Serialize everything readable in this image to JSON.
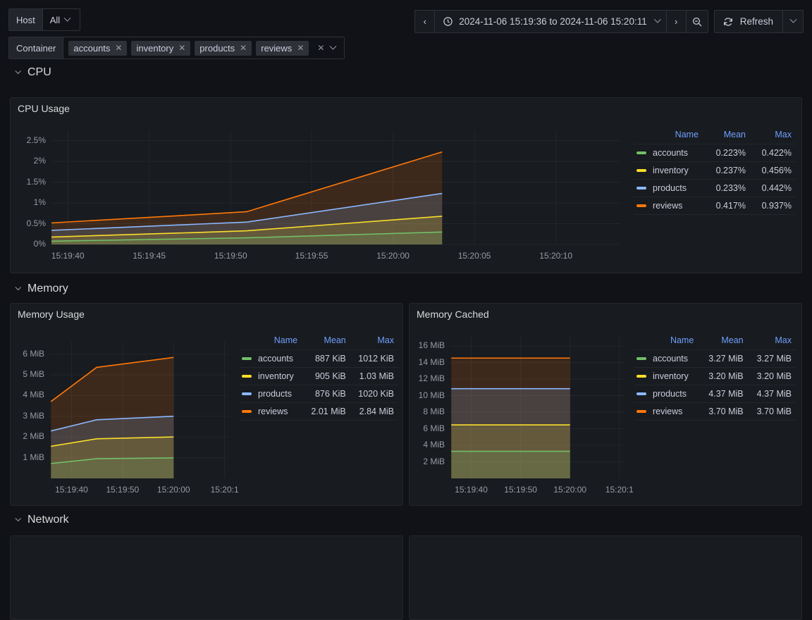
{
  "variables": [
    {
      "name": "host",
      "label": "Host",
      "type": "single",
      "value": "All"
    },
    {
      "name": "container",
      "label": "Container",
      "type": "multi",
      "values": [
        "accounts",
        "inventory",
        "products",
        "reviews"
      ],
      "remove_glyph": "✕",
      "clear_glyph": "✕"
    }
  ],
  "timepicker": {
    "prev_label": "‹",
    "next_label": "›",
    "range": "2024-11-06 15:19:36 to 2024-11-06 15:20:11",
    "clock_icon": "clock-icon",
    "zoom_out_icon": "zoom-out-icon",
    "refresh_label": "Refresh",
    "refresh_icon": "refresh-icon"
  },
  "rows": [
    {
      "name": "cpu",
      "title": "CPU"
    },
    {
      "name": "memory",
      "title": "Memory"
    },
    {
      "name": "network",
      "title": "Network"
    }
  ],
  "colors": {
    "accounts": "#73BF69",
    "inventory": "#FADE2A",
    "products": "#8AB8FF",
    "reviews": "#FF780A",
    "panel_bg": "#181b1f",
    "page_bg": "#111217",
    "grid": "#23262b",
    "header_blue": "#6e9fff"
  },
  "legend_headers": {
    "name": "Name",
    "mean": "Mean",
    "max": "Max"
  },
  "panels": [
    {
      "name": "cpu-usage",
      "title": "CPU Usage",
      "legend": [
        {
          "series": "accounts",
          "mean": "0.223%",
          "max": "0.422%"
        },
        {
          "series": "inventory",
          "mean": "0.237%",
          "max": "0.456%"
        },
        {
          "series": "products",
          "mean": "0.233%",
          "max": "0.442%"
        },
        {
          "series": "reviews",
          "mean": "0.417%",
          "max": "0.937%"
        }
      ]
    },
    {
      "name": "memory-usage",
      "title": "Memory Usage",
      "legend": [
        {
          "series": "accounts",
          "mean": "887 KiB",
          "max": "1012 KiB"
        },
        {
          "series": "inventory",
          "mean": "905 KiB",
          "max": "1.03 MiB"
        },
        {
          "series": "products",
          "mean": "876 KiB",
          "max": "1020 KiB"
        },
        {
          "series": "reviews",
          "mean": "2.01 MiB",
          "max": "2.84 MiB"
        }
      ]
    },
    {
      "name": "memory-cached",
      "title": "Memory Cached",
      "legend": [
        {
          "series": "accounts",
          "mean": "3.27 MiB",
          "max": "3.27 MiB"
        },
        {
          "series": "inventory",
          "mean": "3.20 MiB",
          "max": "3.20 MiB"
        },
        {
          "series": "products",
          "mean": "4.37 MiB",
          "max": "4.37 MiB"
        },
        {
          "series": "reviews",
          "mean": "3.70 MiB",
          "max": "3.70 MiB"
        }
      ]
    }
  ],
  "chart_data": [
    {
      "panel": "cpu-usage",
      "type": "area",
      "stacked": true,
      "title": "CPU Usage",
      "xlabel": "",
      "ylabel": "",
      "ylim": [
        0,
        2.75
      ],
      "yticks": [
        "0%",
        "0.5%",
        "1%",
        "1.5%",
        "2%",
        "2.5%"
      ],
      "ytick_values": [
        0,
        0.5,
        1,
        1.5,
        2,
        2.5
      ],
      "xticks": [
        "15:19:40",
        "15:19:45",
        "15:19:50",
        "15:19:55",
        "15:20:00",
        "15:20:05",
        "15:20:10"
      ],
      "grid": true,
      "legend_position": "right",
      "x": [
        "15:19:36",
        "15:19:45",
        "15:19:48",
        "15:20:00"
      ],
      "series": [
        {
          "name": "accounts",
          "values": [
            0.08,
            0.14,
            0.16,
            0.3
          ]
        },
        {
          "name": "inventory",
          "values": [
            0.1,
            0.15,
            0.17,
            0.38
          ]
        },
        {
          "name": "products",
          "values": [
            0.16,
            0.2,
            0.21,
            0.55
          ]
        },
        {
          "name": "reviews",
          "values": [
            0.18,
            0.23,
            0.25,
            1.0
          ]
        }
      ],
      "cumulative": [
        {
          "name": "accounts",
          "values": [
            0.08,
            0.14,
            0.16,
            0.3
          ]
        },
        {
          "name": "inventory",
          "values": [
            0.18,
            0.29,
            0.33,
            0.68
          ]
        },
        {
          "name": "products",
          "values": [
            0.34,
            0.49,
            0.54,
            1.23
          ]
        },
        {
          "name": "reviews",
          "values": [
            0.52,
            0.72,
            0.79,
            2.23
          ]
        }
      ]
    },
    {
      "panel": "memory-usage",
      "type": "area",
      "stacked": true,
      "title": "Memory Usage",
      "xlabel": "",
      "ylabel": "",
      "ylim": [
        0,
        6.6
      ],
      "yticks": [
        "1 MiB",
        "2 MiB",
        "3 MiB",
        "4 MiB",
        "5 MiB",
        "6 MiB"
      ],
      "ytick_values": [
        1,
        2,
        3,
        4,
        5,
        6
      ],
      "xticks": [
        "15:19:40",
        "15:19:50",
        "15:20:00",
        "15:20:1"
      ],
      "grid": true,
      "legend_position": "right",
      "x": [
        "15:19:36",
        "15:19:45",
        "15:20:00"
      ],
      "series": [
        {
          "name": "accounts",
          "values": [
            0.72,
            0.95,
            0.99
          ]
        },
        {
          "name": "inventory",
          "values": [
            0.83,
            0.96,
            1.01
          ]
        },
        {
          "name": "products",
          "values": [
            0.74,
            0.92,
            1.0
          ]
        },
        {
          "name": "reviews",
          "values": [
            1.42,
            2.53,
            2.84
          ]
        }
      ],
      "cumulative": [
        {
          "name": "accounts",
          "values": [
            0.72,
            0.95,
            0.99
          ]
        },
        {
          "name": "inventory",
          "values": [
            1.55,
            1.91,
            2.0
          ]
        },
        {
          "name": "products",
          "values": [
            2.29,
            2.83,
            3.0
          ]
        },
        {
          "name": "reviews",
          "values": [
            3.71,
            5.36,
            5.84
          ]
        }
      ]
    },
    {
      "panel": "memory-cached",
      "type": "area",
      "stacked": true,
      "title": "Memory Cached",
      "xlabel": "",
      "ylabel": "",
      "ylim": [
        0,
        17.2
      ],
      "yticks": [
        "2 MiB",
        "4 MiB",
        "6 MiB",
        "8 MiB",
        "10 MiB",
        "12 MiB",
        "14 MiB",
        "16 MiB"
      ],
      "ytick_values": [
        2,
        4,
        6,
        8,
        10,
        12,
        14,
        16
      ],
      "xticks": [
        "15:19:40",
        "15:19:50",
        "15:20:00",
        "15:20:1"
      ],
      "grid": true,
      "legend_position": "right",
      "x": [
        "15:19:36",
        "15:20:00"
      ],
      "series": [
        {
          "name": "accounts",
          "values": [
            3.27,
            3.27
          ]
        },
        {
          "name": "inventory",
          "values": [
            3.2,
            3.2
          ]
        },
        {
          "name": "products",
          "values": [
            4.37,
            4.37
          ]
        },
        {
          "name": "reviews",
          "values": [
            3.7,
            3.7
          ]
        }
      ],
      "cumulative": [
        {
          "name": "accounts",
          "values": [
            3.27,
            3.27
          ]
        },
        {
          "name": "inventory",
          "values": [
            6.47,
            6.47
          ]
        },
        {
          "name": "products",
          "values": [
            10.84,
            10.84
          ]
        },
        {
          "name": "reviews",
          "values": [
            14.54,
            14.54
          ]
        }
      ]
    }
  ]
}
